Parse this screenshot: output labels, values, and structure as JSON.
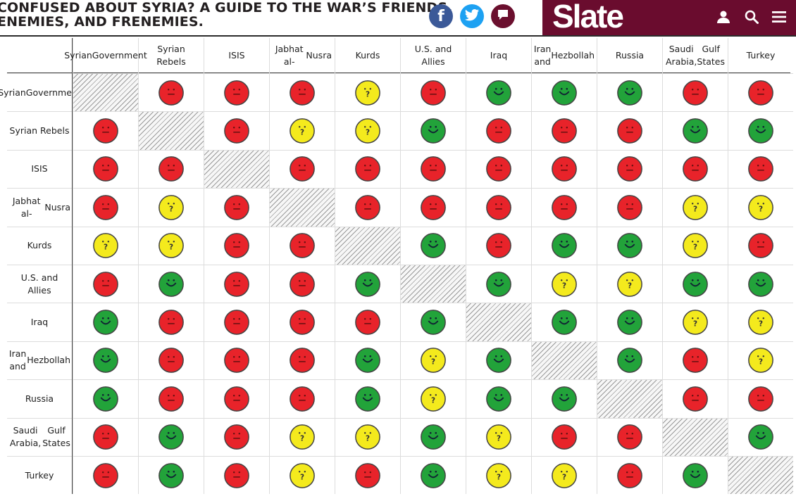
{
  "header": {
    "headline_line1": "CONFUSED ABOUT SYRIA? A GUIDE TO THE WAR’S FRIENDS,",
    "headline_line2": "ENEMIES, AND FRENEMIES.",
    "share": {
      "facebook_glyph": "f",
      "twitter_icon": "twitter-bird-icon",
      "comment_icon": "comment-bubble-icon"
    },
    "brand": {
      "logo": "Slate",
      "color": "#6a0c2e",
      "icons": [
        "user-icon",
        "search-icon",
        "menu-icon"
      ]
    }
  },
  "colors": {
    "friend": "#22a33a",
    "enemy": "#e8232a",
    "complicated": "#f4ea1d"
  },
  "parties": [
    "Syrian Government",
    "Syrian Rebels",
    "ISIS",
    "Jabhat al-Nusra",
    "Kurds",
    "U.S. and Allies",
    "Iraq",
    "Iran and Hezbollah",
    "Russia",
    "Saudi Arabia, Gulf States",
    "Turkey"
  ],
  "column_headers": [
    [
      "Syrian",
      "Government"
    ],
    [
      "Syrian Rebels"
    ],
    [
      "ISIS"
    ],
    [
      "Jabhat al-",
      "Nusra"
    ],
    [
      "Kurds"
    ],
    [
      "U.S. and Allies"
    ],
    [
      "Iraq"
    ],
    [
      "Iran and",
      "Hezbollah"
    ],
    [
      "Russia"
    ],
    [
      "Saudi Arabia,",
      "Gulf States"
    ],
    [
      "Turkey"
    ]
  ],
  "row_headers": [
    [
      "Syrian",
      "Government"
    ],
    [
      "Syrian Rebels"
    ],
    [
      "ISIS"
    ],
    [
      "Jabhat al-",
      "Nusra"
    ],
    [
      "Kurds"
    ],
    [
      "U.S. and Allies"
    ],
    [
      "Iraq"
    ],
    [
      "Iran and",
      "Hezbollah"
    ],
    [
      "Russia"
    ],
    [
      "Saudi Arabia,",
      "Gulf States"
    ],
    [
      "Turkey"
    ]
  ],
  "relationships": [
    [
      "self",
      "enemy",
      "enemy",
      "enemy",
      "complicated",
      "enemy",
      "friend",
      "friend",
      "friend",
      "enemy",
      "enemy"
    ],
    [
      "enemy",
      "self",
      "enemy",
      "complicated",
      "complicated",
      "friend",
      "enemy",
      "enemy",
      "enemy",
      "friend",
      "friend"
    ],
    [
      "enemy",
      "enemy",
      "self",
      "enemy",
      "enemy",
      "enemy",
      "enemy",
      "enemy",
      "enemy",
      "enemy",
      "enemy"
    ],
    [
      "enemy",
      "complicated",
      "enemy",
      "self",
      "enemy",
      "enemy",
      "enemy",
      "enemy",
      "enemy",
      "complicated",
      "complicated"
    ],
    [
      "complicated",
      "complicated",
      "enemy",
      "enemy",
      "self",
      "friend",
      "enemy",
      "friend",
      "friend",
      "complicated",
      "enemy"
    ],
    [
      "enemy",
      "friend",
      "enemy",
      "enemy",
      "friend",
      "self",
      "friend",
      "complicated",
      "complicated",
      "friend",
      "friend"
    ],
    [
      "friend",
      "enemy",
      "enemy",
      "enemy",
      "enemy",
      "friend",
      "self",
      "friend",
      "friend",
      "complicated",
      "complicated"
    ],
    [
      "friend",
      "enemy",
      "enemy",
      "enemy",
      "friend",
      "complicated",
      "friend",
      "self",
      "friend",
      "enemy",
      "complicated"
    ],
    [
      "friend",
      "enemy",
      "enemy",
      "enemy",
      "friend",
      "complicated",
      "friend",
      "friend",
      "self",
      "enemy",
      "enemy"
    ],
    [
      "enemy",
      "friend",
      "enemy",
      "complicated",
      "complicated",
      "friend",
      "complicated",
      "enemy",
      "enemy",
      "self",
      "friend"
    ],
    [
      "enemy",
      "friend",
      "enemy",
      "complicated",
      "enemy",
      "friend",
      "complicated",
      "complicated",
      "enemy",
      "friend",
      "self"
    ]
  ]
}
